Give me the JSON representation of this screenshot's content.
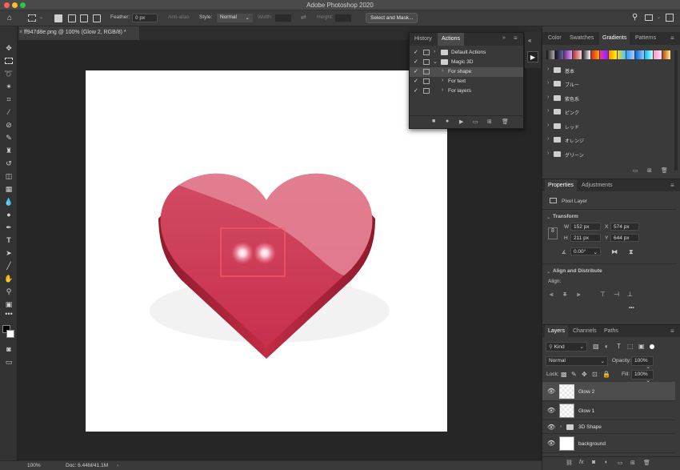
{
  "app": {
    "title": "Adobe Photoshop 2020"
  },
  "options_bar": {
    "feather_label": "Feather:",
    "feather_value": "0 px",
    "anti_alias_label": "Anti-alias",
    "style_label": "Style:",
    "style_value": "Normal",
    "width_label": "Width:",
    "height_label": "Height:",
    "select_mask_label": "Select and Mask..."
  },
  "document": {
    "tab_title": "ff947d8e.png @ 100% (Glow 2, RGB/8) *",
    "tab_close": "×",
    "zoom": "100%",
    "doc_info": "Doc: 6.44M/41.1M"
  },
  "actions_panel": {
    "tabs": [
      "History",
      "Actions"
    ],
    "active_tab": "Actions",
    "rows": [
      {
        "label": "Default Actions",
        "type": "set",
        "checked": true
      },
      {
        "label": "Magic 3D",
        "type": "set",
        "checked": true,
        "expanded": true
      },
      {
        "label": "For shape",
        "type": "action",
        "checked": true,
        "selected": true
      },
      {
        "label": "For text",
        "type": "action",
        "checked": true
      },
      {
        "label": "For layers",
        "type": "action",
        "checked": true
      }
    ]
  },
  "top_panel": {
    "tabs": [
      "Color",
      "Swatches",
      "Gradients",
      "Patterns"
    ],
    "active_tab": "Gradients",
    "gradient_groups": [
      "基本",
      "ブルー",
      "紫色系",
      "ピンク",
      "レッド",
      "オレンジ",
      "グリーン"
    ]
  },
  "properties_panel": {
    "tabs": [
      "Properties",
      "Adjustments"
    ],
    "active_tab": "Properties",
    "layer_type": "Pixel Layer",
    "transform_title": "Transform",
    "w_label": "W",
    "w_value": "152 px",
    "x_label": "X",
    "x_value": "574 px",
    "h_label": "H",
    "h_value": "211 px",
    "y_label": "Y",
    "y_value": "644 px",
    "angle_value": "0.00°",
    "align_title": "Align and Distribute",
    "align_label": "Align:",
    "more": "•••"
  },
  "layers_panel": {
    "tabs": [
      "Layers",
      "Channels",
      "Paths"
    ],
    "active_tab": "Layers",
    "kind_label": "Kind",
    "blend_mode": "Normal",
    "opacity_label": "Opacity:",
    "opacity_value": "100%",
    "lock_label": "Lock:",
    "fill_label": "Fill:",
    "fill_value": "100%",
    "layers": [
      {
        "name": "Glow 2",
        "selected": true
      },
      {
        "name": "Glow 1",
        "selected": false
      },
      {
        "name": "3D Shape",
        "group": true
      },
      {
        "name": "background",
        "selected": false
      }
    ]
  },
  "colors": {
    "heart_top": "#d4697d",
    "heart_main": "#c23a55",
    "heart_side": "#9e1f33",
    "selection": "#ff5a6a"
  }
}
